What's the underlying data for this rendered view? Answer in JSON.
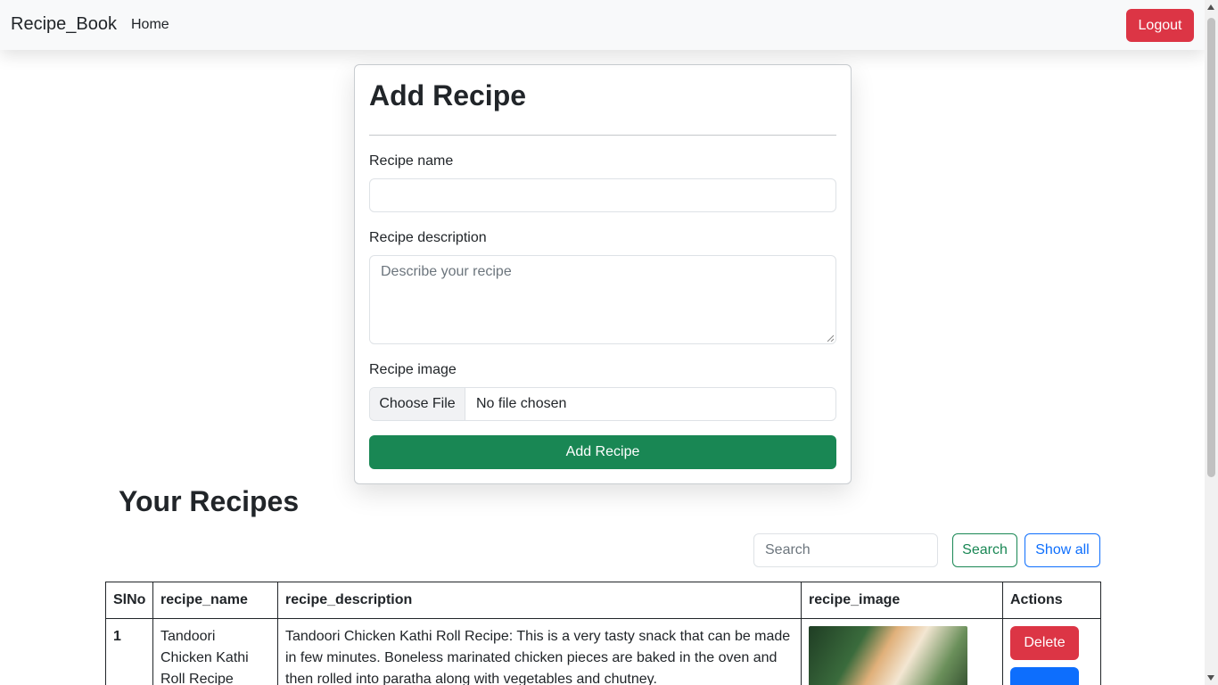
{
  "navbar": {
    "brand": "Recipe_Book",
    "home_link": "Home",
    "logout_label": "Logout"
  },
  "form": {
    "title": "Add Recipe",
    "name_label": "Recipe name",
    "name_value": "",
    "description_label": "Recipe description",
    "description_placeholder": "Describe your recipe",
    "image_label": "Recipe image",
    "choose_file_label": "Choose File",
    "file_status": "No file chosen",
    "submit_label": "Add Recipe"
  },
  "recipes": {
    "title": "Your Recipes",
    "search_placeholder": "Search",
    "search_label": "Search",
    "show_all_label": "Show all",
    "columns": [
      "SlNo",
      "recipe_name",
      "recipe_description",
      "recipe_image",
      "Actions"
    ],
    "rows": [
      {
        "slno": "1",
        "name": "Tandoori Chicken Kathi Roll Recipe",
        "description": "Tandoori Chicken Kathi Roll Recipe: This is a very tasty snack that can be made in few minutes. Boneless marinated chicken pieces are baked in the oven and then rolled into paratha along with vegetables and chutney.",
        "delete_label": "Delete"
      }
    ]
  },
  "colors": {
    "danger": "#dc3545",
    "success": "#198754",
    "primary": "#0d6efd"
  }
}
